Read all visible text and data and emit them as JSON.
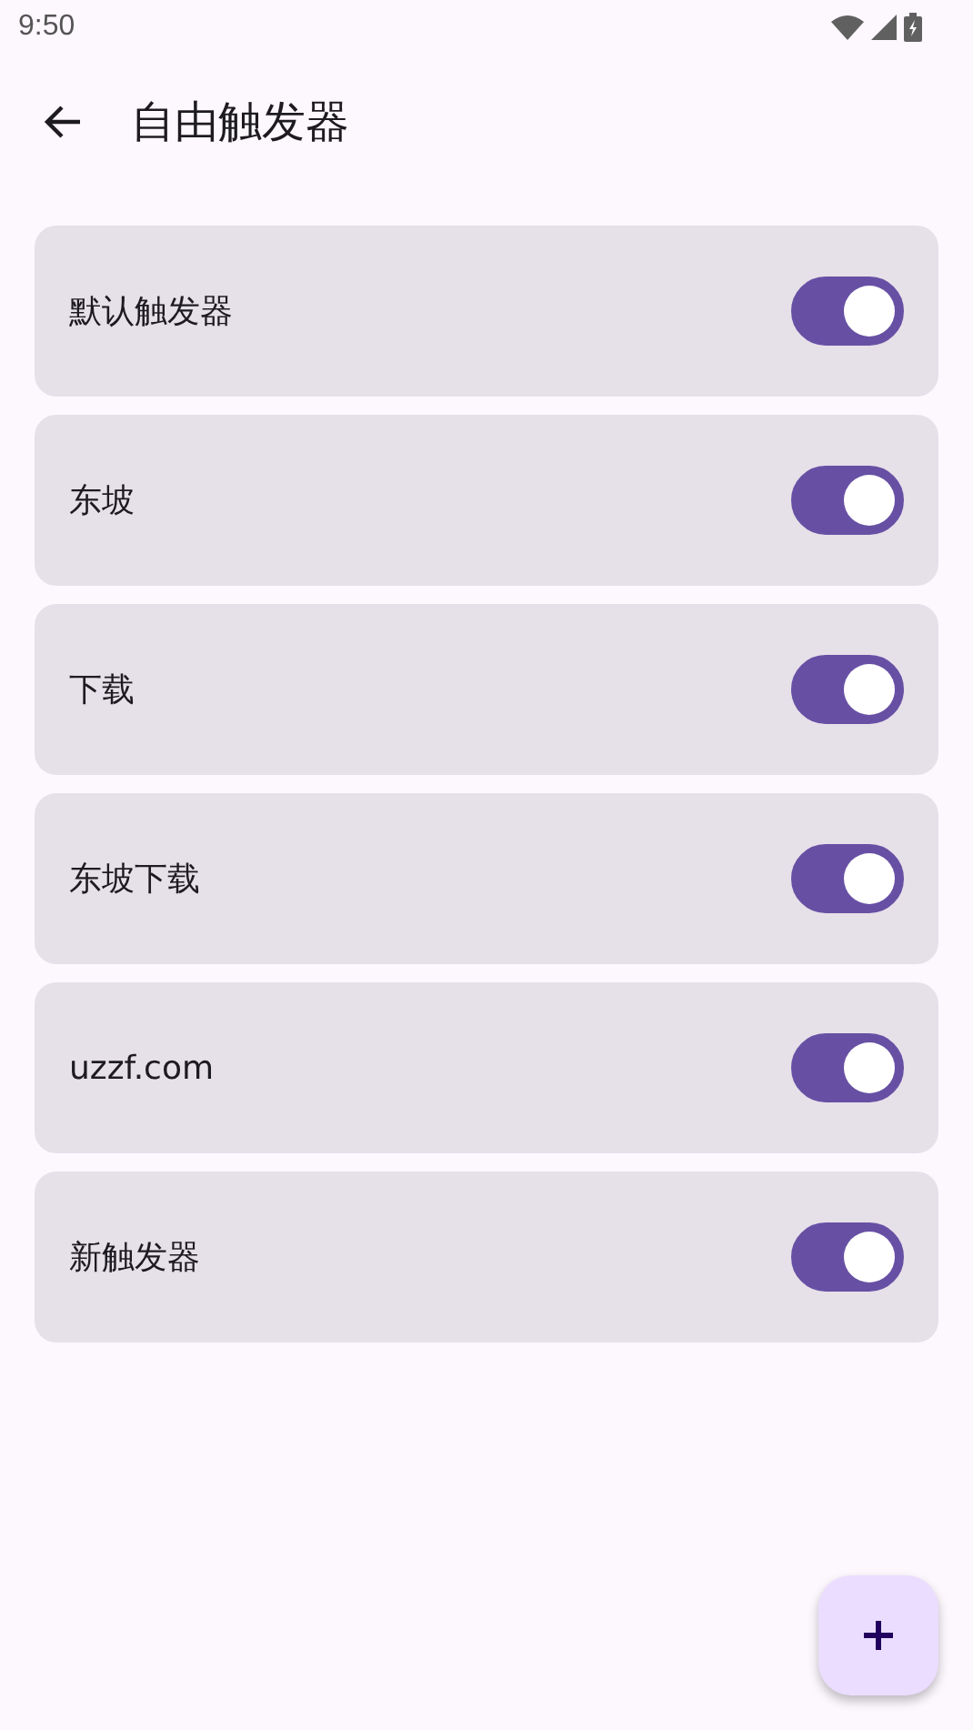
{
  "status_bar": {
    "time": "9:50"
  },
  "app_bar": {
    "title": "自由触发器"
  },
  "triggers": [
    {
      "name": "默认触发器",
      "on": true
    },
    {
      "name": "东坡",
      "on": true
    },
    {
      "name": "下载",
      "on": true
    },
    {
      "name": "东坡下载",
      "on": true
    },
    {
      "name": "uzzf.com",
      "on": true
    },
    {
      "name": "新触发器",
      "on": true
    }
  ]
}
